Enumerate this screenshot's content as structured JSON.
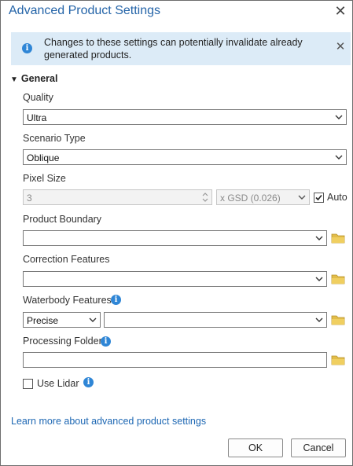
{
  "dialog": {
    "title": "Advanced Product Settings",
    "close_icon": "close-icon"
  },
  "banner": {
    "icon": "info-icon",
    "text": "Changes to these settings can potentially invalidate already generated products.",
    "close_icon": "close-icon"
  },
  "section": {
    "label": "General",
    "icon": "chevron-down-icon"
  },
  "quality": {
    "label": "Quality",
    "value": "Ultra"
  },
  "scenario": {
    "label": "Scenario Type",
    "value": "Oblique"
  },
  "pixel_size": {
    "label": "Pixel Size",
    "value": "3",
    "unit": "x GSD (0.026)",
    "auto_label": "Auto",
    "auto_checked": true
  },
  "product_boundary": {
    "label": "Product Boundary",
    "value": ""
  },
  "correction_features": {
    "label": "Correction Features",
    "value": ""
  },
  "waterbody_features": {
    "label": "Waterbody Features",
    "mode": "Precise",
    "value": ""
  },
  "processing_folder": {
    "label": "Processing Folder",
    "value": ""
  },
  "use_lidar": {
    "label": "Use Lidar",
    "checked": false
  },
  "learn_more": "Learn more about advanced product settings",
  "buttons": {
    "ok": "OK",
    "cancel": "Cancel"
  },
  "colors": {
    "accent": "#2464a8",
    "banner_bg": "#dcebf7",
    "info": "#2f86d6",
    "folder": "#d8b13a"
  }
}
